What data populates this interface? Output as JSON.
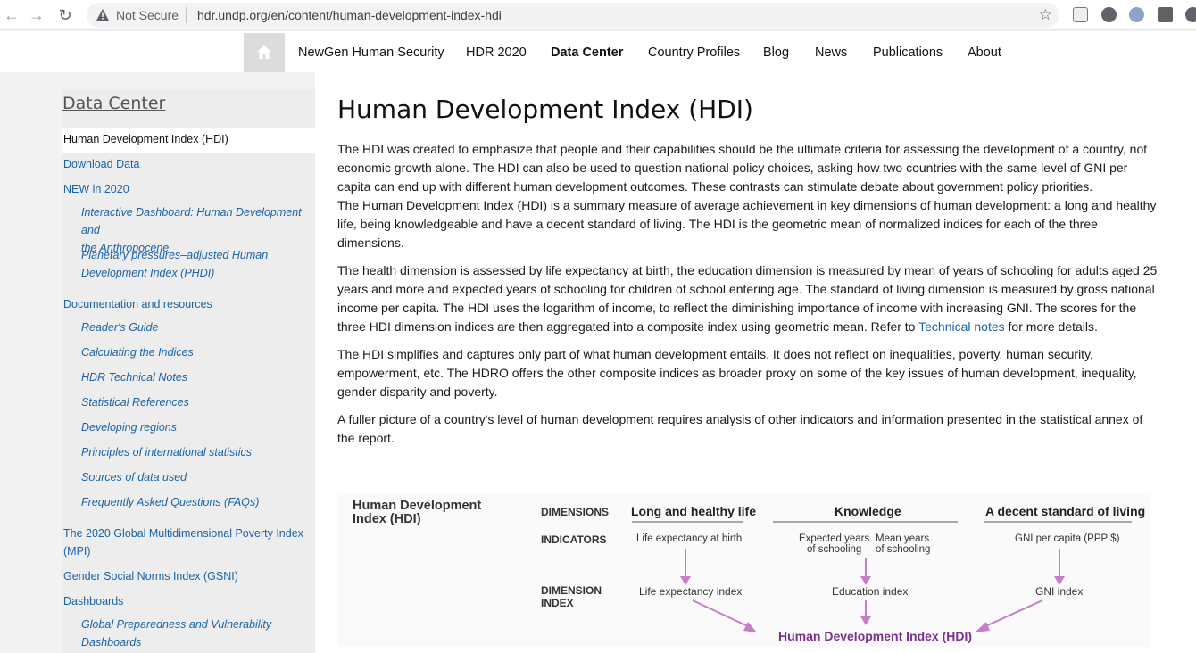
{
  "browser": {
    "security_label": "Not Secure",
    "url": "hdr.undp.org/en/content/human-development-index-hdi"
  },
  "nav": {
    "items": [
      "NewGen Human Security",
      "HDR 2020",
      "Data Center",
      "Country Profiles",
      "Blog",
      "News",
      "Publications",
      "About"
    ],
    "active": "Data Center"
  },
  "sidebar": {
    "title": "Data Center",
    "active_item": "Human Development Index (HDI)",
    "links": {
      "download": "Download Data",
      "new2020": "NEW in 2020",
      "docs": "Documentation and resources",
      "mpi_1": "The 2020 Global Multidimensional Poverty Index",
      "mpi_2": "(MPI)",
      "gsni": "Gender Social Norms Index (GSNI)",
      "dashboards": "Dashboards"
    },
    "sub": {
      "dash_1": "Interactive Dashboard: Human Development and",
      "dash_2": "the Anthropocene",
      "phdi_1": "Planetary pressures–adjusted Human",
      "phdi_2": "Development Index (PHDI)",
      "readers": "Reader's Guide",
      "calc": "Calculating the Indices",
      "technotes": "HDR Technical Notes",
      "statref": "Statistical References",
      "devreg": "Developing regions",
      "principles": "Principles of international statistics",
      "sources": "Sources of data used",
      "faq": "Frequently Asked Questions (FAQs)",
      "gpv_1": "Global Preparedness and Vulnerability",
      "gpv_2": "Dashboards"
    }
  },
  "main": {
    "title": "Human Development Index (HDI)",
    "p1": "The HDI was created to emphasize that people and their capabilities should be the ultimate criteria for assessing the development of a country, not economic growth alone. The HDI can also be used to question national policy choices, asking how two countries with the same level of GNI per capita can end up with different human development outcomes. These contrasts can stimulate debate about government policy priorities.",
    "p1b": "The Human Development Index (HDI) is a summary measure of average achievement in key dimensions of human development: a long and healthy life, being knowledgeable and have a decent standard of living. The HDI is the geometric mean of normalized indices for each of the three dimensions.",
    "p2": "The health dimension is assessed by life expectancy at birth, the education dimension is measured by mean of years of schooling for adults aged 25 years and more and expected years of schooling for children of school entering age. The standard of living dimension is measured by gross national income per capita. The HDI uses the logarithm of income, to reflect the diminishing importance of income with increasing GNI. The scores for the three HDI dimension indices are then aggregated into a composite index using geometric mean. Refer to",
    "p2_link": "Technical notes",
    "p2_end": "for more details.",
    "p3": "The HDI simplifies and captures only part of what human development entails. It does not reflect on inequalities, poverty, human security, empowerment, etc. The HDRO offers the other composite indices as broader proxy on some of the key issues of human development, inequality, gender disparity and poverty.",
    "p4": "A fuller picture of a country's level of human development requires analysis of other indicators and information presented in the statistical annex of the report."
  },
  "diagram": {
    "title_1": "Human Development",
    "title_2": "Index (HDI)",
    "row_dimensions": "DIMENSIONS",
    "row_indicators": "INDICATORS",
    "row_index_1": "DIMENSION",
    "row_index_2": "INDEX",
    "dim_health": "Long and healthy life",
    "dim_knowledge": "Knowledge",
    "dim_living": "A decent standard of living",
    "ind_life": "Life expectancy at birth",
    "ind_expected_1": "Expected years",
    "ind_expected_2": "of schooling",
    "ind_mean_1": "Mean years",
    "ind_mean_2": "of schooling",
    "ind_gni": "GNI per capita (PPP $)",
    "idx_life": "Life expectancy index",
    "idx_edu": "Education index",
    "idx_gni": "GNI index",
    "hdi": "Human Development Index (HDI)",
    "arrow_color": "#c77dc7",
    "hdi_color": "#7b2f8e"
  }
}
